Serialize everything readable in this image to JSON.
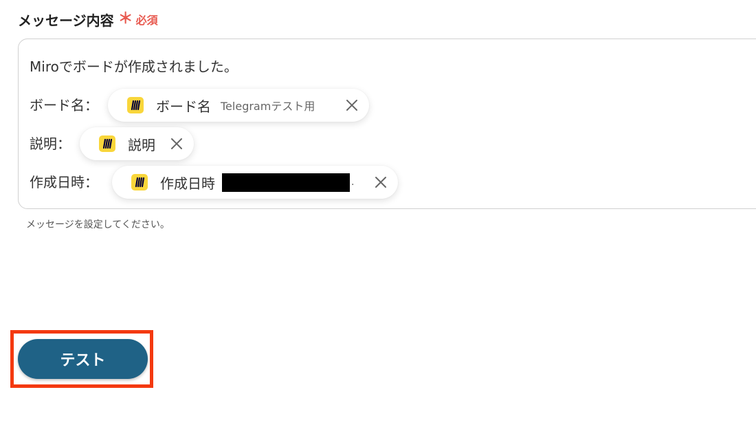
{
  "field": {
    "label": "メッセージ内容",
    "required_mark": "＊",
    "required_text": "必須",
    "required_color": "#e85a50"
  },
  "message": {
    "line1": "Miroでボードが作成されました。",
    "lines": [
      {
        "label": "ボード名：",
        "chip": {
          "icon": "miro-icon",
          "name": "ボード名",
          "sub": "Telegramテスト用"
        }
      },
      {
        "label": "説明：",
        "chip": {
          "icon": "miro-icon",
          "name": "説明",
          "sub": ""
        }
      },
      {
        "label": "作成日時：",
        "chip": {
          "icon": "miro-icon",
          "name": "作成日時",
          "sub": "."
        }
      }
    ]
  },
  "helper_text": "メッセージを設定してください。",
  "test_button": {
    "label": "テスト",
    "color": "#1f6286",
    "highlight_color": "#f4390f"
  },
  "colors": {
    "miro_yellow": "#f9d63b"
  }
}
